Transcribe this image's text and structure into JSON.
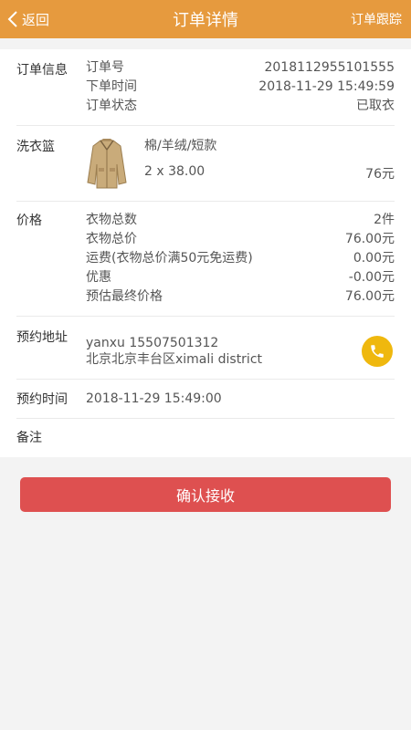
{
  "header": {
    "back_label": "返回",
    "title": "订单详情",
    "track_label": "订单跟踪"
  },
  "order_info": {
    "label": "订单信息",
    "rows": [
      {
        "key": "订单号",
        "value": "2018112955101555"
      },
      {
        "key": "下单时间",
        "value": "2018-11-29 15:49:59"
      },
      {
        "key": "订单状态",
        "value": "已取衣"
      }
    ]
  },
  "basket": {
    "label": "洗衣篮",
    "item": {
      "name": "棉/羊绒/短款",
      "qty_price": "2 x 38.00",
      "total": "76元"
    }
  },
  "price": {
    "label": "价格",
    "rows": [
      {
        "key": "衣物总数",
        "value": "2件"
      },
      {
        "key": "衣物总价",
        "value": "76.00元"
      },
      {
        "key": "运费(衣物总价满50元免运费)",
        "value": "0.00元"
      },
      {
        "key": "优惠",
        "value": "-0.00元"
      },
      {
        "key": "预估最终价格",
        "value": "76.00元"
      }
    ]
  },
  "address": {
    "label": "预约地址",
    "line1": "yanxu 15507501312",
    "line2": "北京北京丰台区ximali district"
  },
  "appointment": {
    "label": "预约时间",
    "value": "2018-11-29 15:49:00"
  },
  "note": {
    "label": "备注"
  },
  "confirm_label": "确认接收",
  "colors": {
    "header_bg": "#e69a3e",
    "confirm_bg": "#de5050",
    "phone_bg": "#efb80e"
  }
}
